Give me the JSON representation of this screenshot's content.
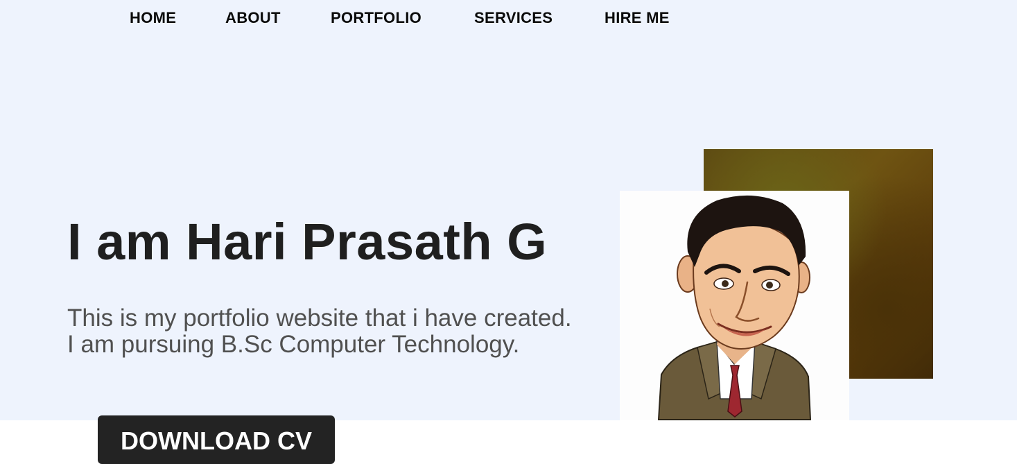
{
  "nav": {
    "items": [
      "HOME",
      "ABOUT",
      "PORTFOLIO",
      "SERVICES",
      "HIRE ME"
    ]
  },
  "hero": {
    "title": "I am Hari Prasath G",
    "description_line1": "This is my portfolio website that i have created.",
    "description_line2": "I am pursuing B.Sc Computer Technology.",
    "download_button": "DOWNLOAD CV"
  },
  "colors": {
    "hero_background": "#eef3fd",
    "button_background": "#232323",
    "title_text": "#1f1f1f",
    "description_text": "#505050"
  },
  "icons": {
    "profile_image": "caricature-portrait"
  }
}
